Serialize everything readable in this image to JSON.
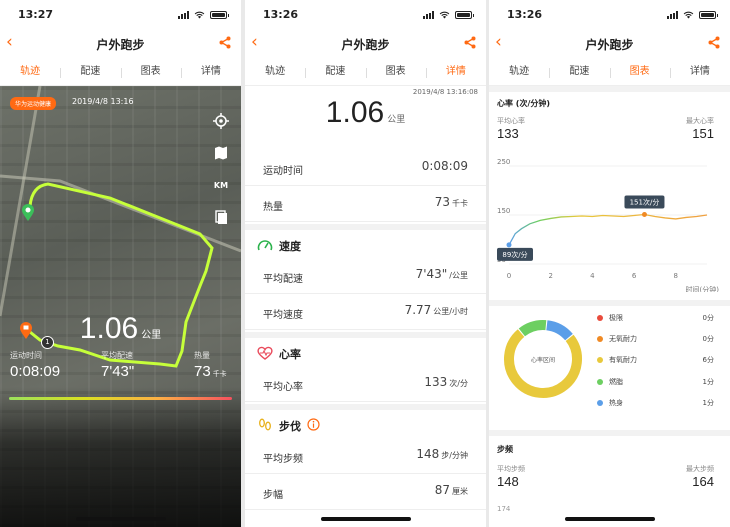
{
  "status": {
    "time_left": "13:27",
    "time_mid": "13:26",
    "time_right": "13:26"
  },
  "nav": {
    "title": "户外跑步"
  },
  "tabs": [
    "轨迹",
    "配速",
    "图表",
    "详情"
  ],
  "map": {
    "badge": "华为运动健康",
    "date": "2019/4/8 13:16",
    "controls": {
      "km": "KM"
    },
    "distance": "1.06",
    "distance_unit": "公里",
    "stats": [
      {
        "label": "运动时间",
        "value": "0:08:09",
        "unit": ""
      },
      {
        "label": "平均配速",
        "value": "7'43\"",
        "unit": ""
      },
      {
        "label": "热量",
        "value": "73",
        "unit": "千卡"
      }
    ],
    "marker_label": "1"
  },
  "details": {
    "date": "2019/4/8 13:16:08",
    "distance": "1.06",
    "distance_unit": "公里",
    "rows_top": [
      {
        "label": "运动时间",
        "value": "0:08:09",
        "unit": ""
      },
      {
        "label": "热量",
        "value": "73",
        "unit": "千卡"
      }
    ],
    "speed": {
      "title": "速度",
      "rows": [
        {
          "label": "平均配速",
          "value": "7'43\"",
          "unit": "/公里"
        },
        {
          "label": "平均速度",
          "value": "7.77",
          "unit": "公里/小时"
        }
      ]
    },
    "heart": {
      "title": "心率",
      "rows": [
        {
          "label": "平均心率",
          "value": "133",
          "unit": "次/分"
        }
      ]
    },
    "steps": {
      "title": "步伐",
      "rows": [
        {
          "label": "平均步频",
          "value": "148",
          "unit": "步/分钟"
        },
        {
          "label": "步幅",
          "value": "87",
          "unit": "厘米"
        }
      ]
    }
  },
  "chart": {
    "title": "心率 (次/分钟)",
    "avg_label": "平均心率",
    "avg_value": "133",
    "max_label": "最大心率",
    "max_value": "151",
    "xaxis_label": "时间(分钟)",
    "max_tooltip": "151次/分",
    "min_tooltip": "89次/分",
    "donut_label": "心率区间",
    "zones": [
      {
        "name": "极限",
        "value": "0分",
        "color": "#e94b3c",
        "minutes": 0
      },
      {
        "name": "无氧耐力",
        "value": "0分",
        "color": "#f08a24",
        "minutes": 0
      },
      {
        "name": "有氧耐力",
        "value": "6分",
        "color": "#e8c93c",
        "minutes": 6
      },
      {
        "name": "燃脂",
        "value": "1分",
        "color": "#6dcf61",
        "minutes": 1
      },
      {
        "name": "热身",
        "value": "1分",
        "color": "#5b9ee8",
        "minutes": 1
      }
    ],
    "cadence_title": "步频",
    "cad_avg_label": "平均步频",
    "cad_avg_value": "148",
    "cad_max_label": "最大步频",
    "cad_max_value": "164",
    "cad_axis_tick": "174"
  },
  "chart_data": {
    "type": "line",
    "title": "心率 (次/分钟)",
    "xlabel": "时间(分钟)",
    "ylabel": "",
    "xlim": [
      0,
      9.5
    ],
    "ylim": [
      50,
      250
    ],
    "xticks": [
      "0",
      "2",
      "4",
      "6",
      "8"
    ],
    "yticks": [
      "50",
      "150",
      "250"
    ],
    "x": [
      0,
      0.3,
      0.6,
      1.0,
      1.5,
      2.0,
      2.5,
      3.0,
      3.5,
      4.0,
      4.5,
      5.0,
      5.5,
      6.0,
      6.5,
      7.0,
      7.5,
      8.0,
      8.5,
      9.0,
      9.5
    ],
    "y": [
      89,
      112,
      122,
      132,
      139,
      143,
      146,
      147,
      148,
      147,
      149,
      148,
      147,
      149,
      151,
      147,
      144,
      142,
      145,
      147,
      150
    ],
    "annotations": [
      {
        "x": 6.5,
        "y": 151,
        "text": "151次/分"
      },
      {
        "x": 0,
        "y": 89,
        "text": "89次/分"
      }
    ]
  }
}
